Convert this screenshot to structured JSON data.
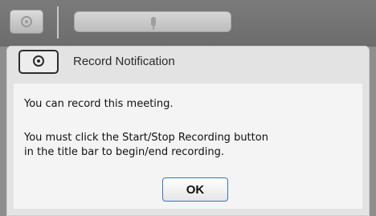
{
  "title_bar": {
    "record_icon": "record-icon",
    "mic_icon": "microphone-icon"
  },
  "dialog": {
    "icon": "record-icon",
    "title": "Record Notification",
    "message_line1": "You can record this meeting.",
    "message_line2": "You must click the Start/Stop Recording button",
    "message_line3": "in the title bar to begin/end recording.",
    "ok_label": "OK"
  },
  "colors": {
    "ok_border": "#3b73b9",
    "dialog_bg": "#e3e3e3",
    "body_bg": "#f4f4f4"
  }
}
